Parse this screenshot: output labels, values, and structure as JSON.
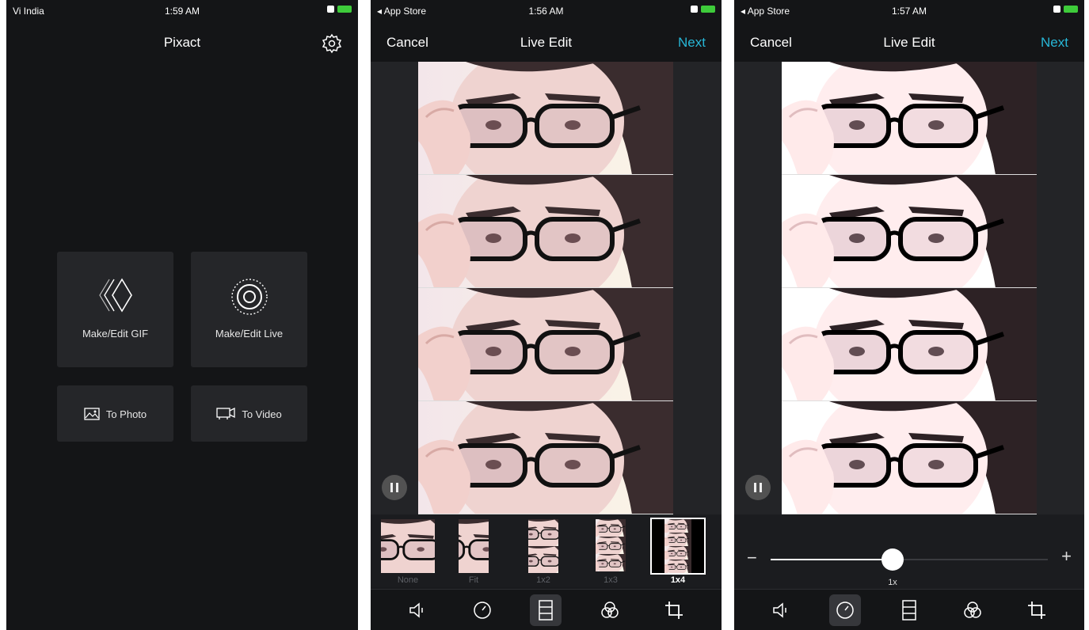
{
  "screens": [
    {
      "status": {
        "carrier": "Vi India",
        "time": "1:59 AM"
      },
      "nav": {
        "title": "Pixact"
      },
      "cards": {
        "make_gif": "Make/Edit GIF",
        "make_live": "Make/Edit Live",
        "to_photo": "To Photo",
        "to_video": "To Video"
      }
    },
    {
      "status": {
        "carrier": "◂ App Store",
        "time": "1:56 AM"
      },
      "nav": {
        "cancel": "Cancel",
        "title": "Live Edit",
        "next": "Next"
      },
      "layout_options": [
        "None",
        "Fit",
        "1x2",
        "1x3",
        "1x4"
      ],
      "selected_layout": "1x4",
      "toolbar": [
        "volume-icon",
        "speed-icon",
        "layout-icon",
        "filter-icon",
        "crop-icon"
      ],
      "active_tool": "layout-icon"
    },
    {
      "status": {
        "carrier": "◂ App Store",
        "time": "1:57 AM"
      },
      "nav": {
        "cancel": "Cancel",
        "title": "Live Edit",
        "next": "Next"
      },
      "speed": {
        "label": "1x",
        "position": 0.44,
        "minus": "−",
        "plus": "+"
      },
      "toolbar": [
        "volume-icon",
        "speed-icon",
        "layout-icon",
        "filter-icon",
        "crop-icon"
      ],
      "active_tool": "speed-icon"
    }
  ],
  "colors": {
    "accent": "#27b6d6",
    "background": "#141517",
    "card": "#252629"
  }
}
